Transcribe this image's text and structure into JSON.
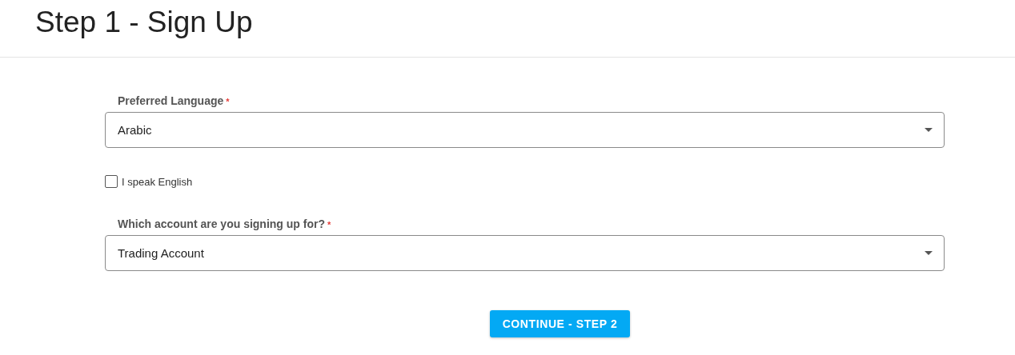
{
  "title": "Step 1 - Sign Up",
  "fields": [
    {
      "kind": "select",
      "label": "Preferred Language",
      "required_mark": "*",
      "value": "Arabic"
    },
    {
      "kind": "checkbox",
      "label": "I speak English",
      "checked": false
    },
    {
      "kind": "select",
      "label": "Which account are you signing up for?",
      "required_mark": "*",
      "value": "Trading Account"
    }
  ],
  "button": "CONTINUE - STEP 2"
}
